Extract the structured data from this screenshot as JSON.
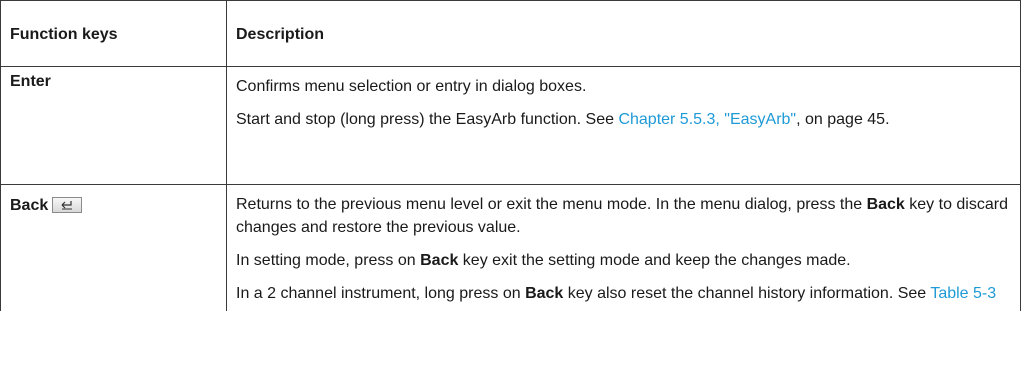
{
  "table": {
    "headers": [
      "Function keys",
      "Description"
    ],
    "rows": [
      {
        "key": "Enter",
        "paragraphs": [
          {
            "text": "Confirms menu selection or entry in dialog boxes."
          },
          {
            "before": "Start and stop (long press) the EasyArb function. See ",
            "link": "Chapter 5.5.3, \"EasyArb\"",
            "after": ", on page 45."
          }
        ]
      },
      {
        "key": "Back",
        "key_icon": "back-key-icon",
        "paragraphs": [
          {
            "before": "Returns to the previous menu level or exit the menu mode. In the menu dialog, press the ",
            "bold": "Back",
            "after": " key to discard changes and restore the previous value."
          },
          {
            "before": "In setting mode, press on ",
            "bold": "Back",
            "after": " key exit the setting mode and keep the changes made."
          },
          {
            "before": "In a 2 channel instrument, long press on ",
            "bold": "Back",
            "after": " key also reset the channel history information. See ",
            "link": "Table 5-3"
          }
        ]
      }
    ]
  },
  "colors": {
    "link": "#1f9ad6",
    "border": "#3a3a3a"
  }
}
